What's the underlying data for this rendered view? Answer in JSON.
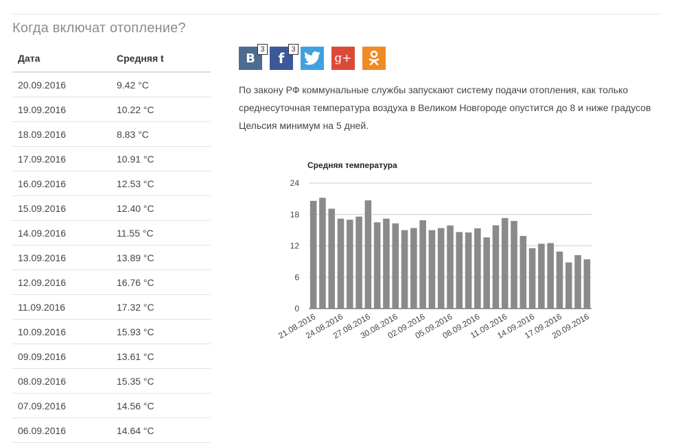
{
  "page": {
    "title": "Когда включат отопление?",
    "intro": "По закону РФ коммунальные службы запускают систему подачи отопления, как только среднесуточная температура воздуха в Великом Новгороде опустится до 8 и ниже градусов Цельсия минимум на 5 дней."
  },
  "share": [
    {
      "name": "vk",
      "label": "В",
      "count": "3",
      "color": "#4c6c91"
    },
    {
      "name": "facebook",
      "label": "f",
      "count": "3",
      "color": "#3b5998"
    },
    {
      "name": "twitter",
      "label": "",
      "count": "",
      "color": "#3fa2e0"
    },
    {
      "name": "googleplus",
      "label": "g+",
      "count": "",
      "color": "#db4a39"
    },
    {
      "name": "odnoklassniki",
      "label": "ok",
      "count": "",
      "color": "#f08a24"
    }
  ],
  "table": {
    "headers": {
      "date": "Дата",
      "temp": "Средняя t"
    },
    "rows": [
      {
        "date": "20.09.2016",
        "temp": "9.42 °C"
      },
      {
        "date": "19.09.2016",
        "temp": "10.22 °C"
      },
      {
        "date": "18.09.2016",
        "temp": "8.83 °C"
      },
      {
        "date": "17.09.2016",
        "temp": "10.91 °C"
      },
      {
        "date": "16.09.2016",
        "temp": "12.53 °C"
      },
      {
        "date": "15.09.2016",
        "temp": "12.40 °C"
      },
      {
        "date": "14.09.2016",
        "temp": "11.55 °C"
      },
      {
        "date": "13.09.2016",
        "temp": "13.89 °C"
      },
      {
        "date": "12.09.2016",
        "temp": "16.76 °C"
      },
      {
        "date": "11.09.2016",
        "temp": "17.32 °C"
      },
      {
        "date": "10.09.2016",
        "temp": "15.93 °C"
      },
      {
        "date": "09.09.2016",
        "temp": "13.61 °C"
      },
      {
        "date": "08.09.2016",
        "temp": "15.35 °C"
      },
      {
        "date": "07.09.2016",
        "temp": "14.56 °C"
      },
      {
        "date": "06.09.2016",
        "temp": "14.64 °C"
      }
    ]
  },
  "chart_data": {
    "type": "bar",
    "title": "Средняя температура",
    "bar_color": "#8a8a8a",
    "grid": true,
    "ylim": [
      0,
      24
    ],
    "yticks": [
      0,
      6,
      12,
      18,
      24
    ],
    "x": [
      "21.08.2016",
      "22.08.2016",
      "23.08.2016",
      "24.08.2016",
      "25.08.2016",
      "26.08.2016",
      "27.08.2016",
      "28.08.2016",
      "29.08.2016",
      "30.08.2016",
      "31.08.2016",
      "01.09.2016",
      "02.09.2016",
      "03.09.2016",
      "04.09.2016",
      "05.09.2016",
      "06.09.2016",
      "07.09.2016",
      "08.09.2016",
      "09.09.2016",
      "10.09.2016",
      "11.09.2016",
      "12.09.2016",
      "13.09.2016",
      "14.09.2016",
      "15.09.2016",
      "16.09.2016",
      "17.09.2016",
      "18.09.2016",
      "19.09.2016",
      "20.09.2016"
    ],
    "values": [
      20.6,
      21.2,
      19.1,
      17.2,
      17.0,
      17.6,
      20.7,
      16.5,
      17.2,
      16.3,
      15.0,
      15.4,
      16.9,
      15.0,
      15.4,
      15.9,
      14.64,
      14.56,
      15.35,
      13.61,
      15.93,
      17.32,
      16.76,
      13.89,
      11.55,
      12.4,
      12.53,
      10.91,
      8.83,
      10.22,
      9.42
    ],
    "xtick_labels": [
      "21.08.2016",
      "24.08.2016",
      "27.08.2016",
      "30.08.2016",
      "02.09.2016",
      "05.09.2016",
      "08.09.2016",
      "11.09.2016",
      "14.09.2016",
      "17.09.2016",
      "20.09.2016"
    ]
  }
}
